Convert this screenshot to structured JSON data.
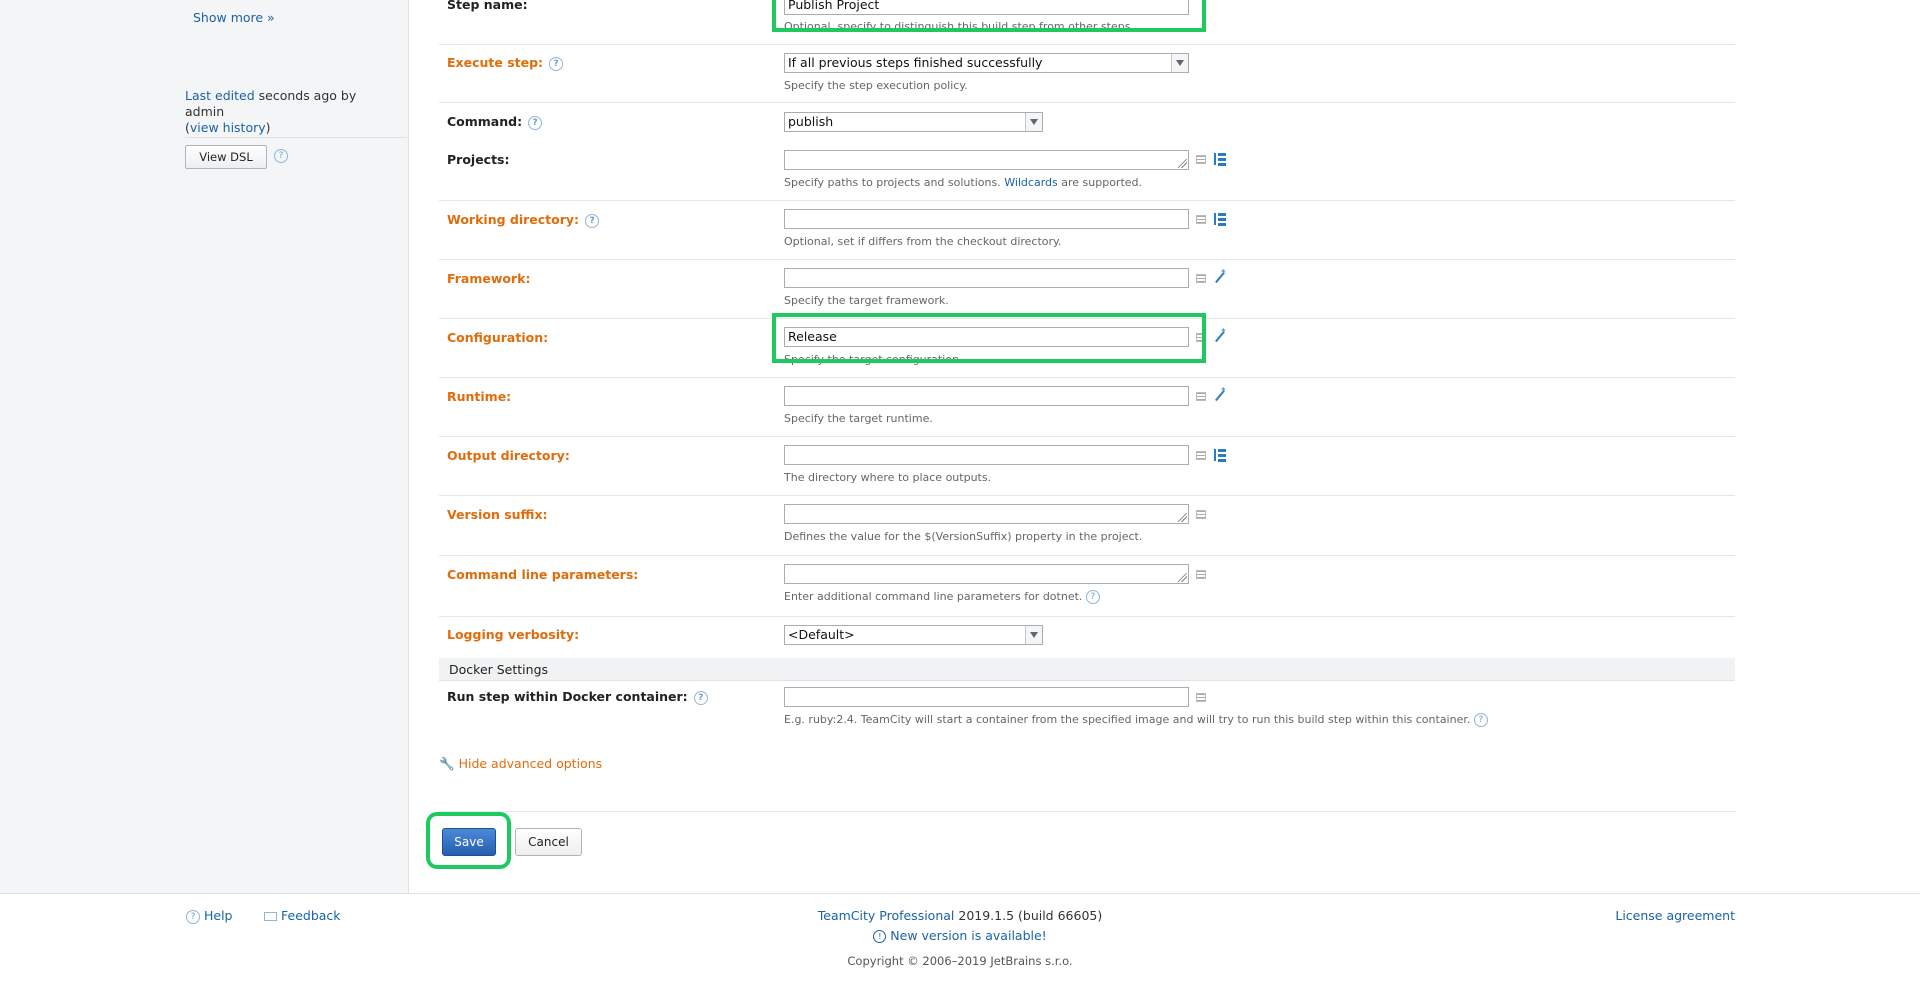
{
  "sidebar": {
    "show_more": "Show more »",
    "last_edited_link": "Last edited",
    "last_edited_text": " seconds ago by admin",
    "view_history_open": "(",
    "view_history": "view history",
    "view_history_close": ")",
    "view_dsl": "View DSL"
  },
  "form": {
    "step_name": {
      "label": "Step name:",
      "value": "Publish Project",
      "hint": "Optional, specify to distinguish this build step from other steps."
    },
    "execute_step": {
      "label": "Execute step:",
      "value": "If all previous steps finished successfully",
      "hint": "Specify the step execution policy."
    },
    "command": {
      "label": "Command:",
      "value": "publish"
    },
    "projects": {
      "label": "Projects:",
      "value": "",
      "hint_before": "Specify paths to projects and solutions. ",
      "hint_link": "Wildcards",
      "hint_after": " are supported."
    },
    "working_directory": {
      "label": "Working directory:",
      "value": "",
      "hint": "Optional, set if differs from the checkout directory."
    },
    "framework": {
      "label": "Framework:",
      "value": "",
      "hint": "Specify the target framework."
    },
    "configuration": {
      "label": "Configuration:",
      "value": "Release",
      "hint": "Specify the target configuration."
    },
    "runtime": {
      "label": "Runtime:",
      "value": "",
      "hint": "Specify the target runtime."
    },
    "output_directory": {
      "label": "Output directory:",
      "value": "",
      "hint": "The directory where to place outputs."
    },
    "version_suffix": {
      "label": "Version suffix:",
      "value": "",
      "hint": "Defines the value for the $(VersionSuffix) property in the project."
    },
    "command_line_parameters": {
      "label": "Command line parameters:",
      "value": "",
      "hint": "Enter additional command line parameters for dotnet."
    },
    "logging_verbosity": {
      "label": "Logging verbosity:",
      "value": "<Default>"
    },
    "docker_section": "Docker Settings",
    "docker_container": {
      "label": "Run step within Docker container:",
      "value": "",
      "hint": "E.g. ruby:2.4. TeamCity will start a container from the specified image and will try to run this build step within this container."
    },
    "hide_advanced": "Hide advanced options"
  },
  "buttons": {
    "save": "Save",
    "cancel": "Cancel"
  },
  "footer": {
    "help": "Help",
    "feedback": "Feedback",
    "product_link": "TeamCity Professional",
    "version": " 2019.1.5 (build 66605)",
    "new_version": "New version is available!",
    "copyright": "Copyright © 2006–2019 JetBrains s.r.o.",
    "license": "License agreement"
  },
  "colors": {
    "accent": "#e06c0b",
    "link": "#1a62a8",
    "highlight": "#1ec960",
    "primary_button": "#245eb0"
  }
}
